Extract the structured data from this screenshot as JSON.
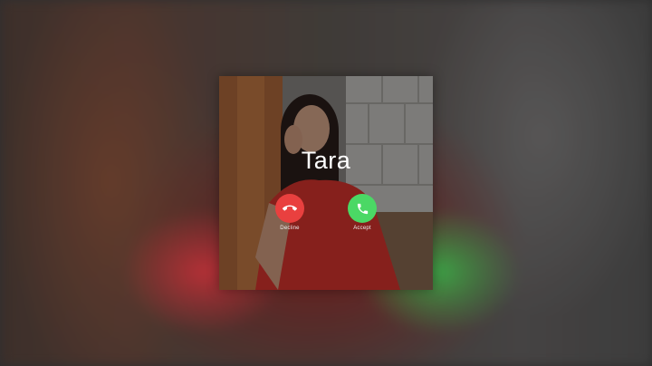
{
  "call": {
    "caller_name": "Tara",
    "decline_label": "Decline",
    "accept_label": "Accept"
  },
  "icons": {
    "decline": "phone-hangup-icon",
    "accept": "phone-icon"
  },
  "colors": {
    "decline": "#e9403f",
    "accept": "#4bd865",
    "text": "#ffffff"
  }
}
